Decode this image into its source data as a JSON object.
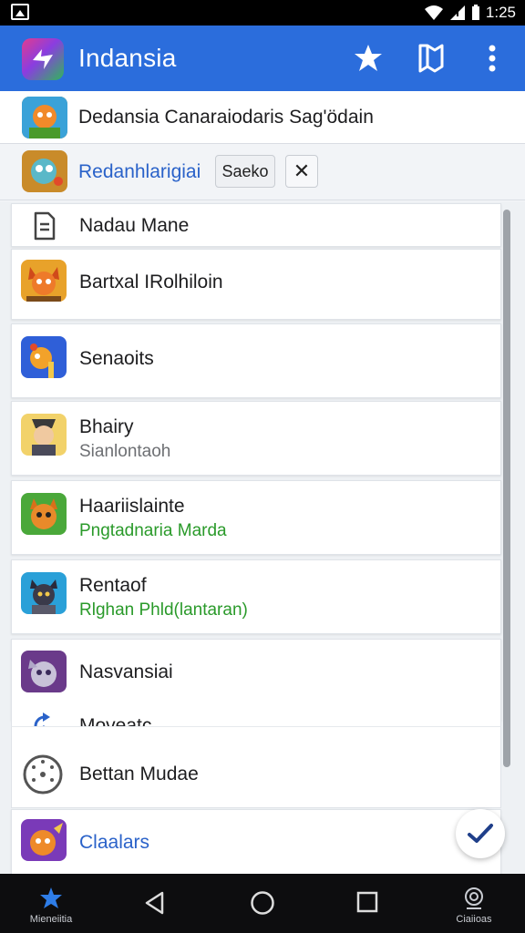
{
  "status_bar": {
    "time": "1:25"
  },
  "app_bar": {
    "title": "Indansia"
  },
  "header": {
    "row1_text": "Dedansia Canaraiodaris Sag'ödain",
    "row2_link": "Redanhlarigiai",
    "row2_button": "Saeko",
    "close_glyph": "✕"
  },
  "list": {
    "items": [
      {
        "title": "Nadau Mane",
        "subtitle": ""
      },
      {
        "title": "Bartxal IRolhiloin",
        "subtitle": ""
      },
      {
        "title": "Senaoits",
        "subtitle": ""
      },
      {
        "title": "Bhairy",
        "subtitle": "Sianlontaoh"
      },
      {
        "title": "Haariislainte",
        "subtitle": "Pngtadnaria Marda"
      },
      {
        "title": "Rentaof",
        "subtitle": "Rlghan Phld(lantaran)"
      },
      {
        "title": "Nasvansiai",
        "subtitle": ""
      },
      {
        "title": "Moveatc",
        "subtitle": ""
      },
      {
        "title": "Bettan Mudae",
        "subtitle": ""
      },
      {
        "title": "Claalars",
        "subtitle": ""
      }
    ]
  },
  "bottom_nav": {
    "left_label": "Mieneiitia",
    "right_label": "Ciaiioas"
  },
  "colors": {
    "accent": "#2b6ddc",
    "link": "#2a62c9",
    "green": "#2a9a2a"
  }
}
